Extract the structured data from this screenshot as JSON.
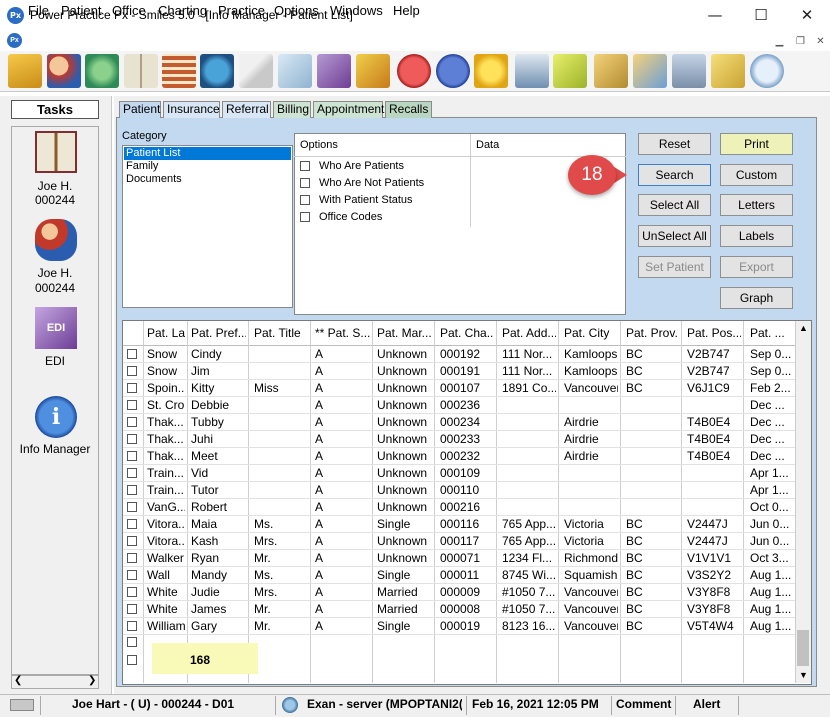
{
  "window": {
    "title": "Power Practice Px - Smiles 5.0 - [Info Manager - Patient List]",
    "app_icon_text": "Px",
    "minimize": "—",
    "maximize": "☐",
    "close": "✕"
  },
  "menu": {
    "items": [
      "File",
      "Patient",
      "Office",
      "Charting",
      "Practice",
      "Options",
      "Windows",
      "Help"
    ]
  },
  "toolbar": {
    "icons": [
      "folder-open-icon",
      "patients-icon",
      "recycle-icon",
      "chart-book-icon",
      "calendar-icon",
      "globe-icon",
      "mail-icon",
      "notes-icon",
      "edi-icon",
      "gift-icon",
      "stop-icon",
      "help-icon",
      "star-icon",
      "spray-icon",
      "postit-icon",
      "cabinet-icon",
      "monitor-folder-icon",
      "calculator-icon",
      "folders-icon",
      "chat-icon"
    ]
  },
  "tasks": {
    "header": "Tasks",
    "items": [
      {
        "label": "Joe H.",
        "sub": "000244",
        "icon": "chart-book-icon"
      },
      {
        "label": "Joe H.",
        "sub": "000244",
        "icon": "patients-icon"
      },
      {
        "label": "EDI",
        "sub": "",
        "icon": "edi-icon"
      },
      {
        "label": "Info Manager",
        "sub": "",
        "icon": "info-icon"
      }
    ]
  },
  "tabs": [
    "Patient",
    "Insurance",
    "Referral",
    "Billing",
    "Appointment",
    "Recalls"
  ],
  "category": {
    "label": "Category",
    "items": [
      "Patient List",
      "Family",
      "Documents"
    ],
    "selected": "Patient List"
  },
  "options": {
    "col_options": "Options",
    "col_data": "Data",
    "items": [
      "Who Are Patients",
      "Who Are Not Patients",
      "With Patient Status",
      "Office Codes"
    ]
  },
  "buttons": {
    "reset": "Reset",
    "print": "Print",
    "search": "Search",
    "custom": "Custom",
    "select_all": "Select All",
    "letters": "Letters",
    "unselect_all": "UnSelect All",
    "labels": "Labels",
    "set_patient": "Set Patient",
    "export": "Export",
    "graph": "Graph"
  },
  "callout": {
    "number": "18"
  },
  "grid": {
    "columns": [
      "Pat. Las...",
      "Pat. Pref...",
      "Pat. Title",
      "** Pat. S...",
      "Pat. Mar...",
      "Pat. Cha...",
      "Pat. Add...",
      "Pat. City",
      "Pat. Prov.",
      "Pat. Pos...",
      "Pat. ..."
    ],
    "rows": [
      [
        "Snow",
        "Cindy",
        "",
        "A",
        "Unknown",
        "000192",
        "111 Nor...",
        "Kamloops",
        "BC",
        "V2B747",
        "Sep 0..."
      ],
      [
        "Snow",
        "Jim",
        "",
        "A",
        "Unknown",
        "000191",
        "111 Nor...",
        "Kamloops",
        "BC",
        "V2B747",
        "Sep 0..."
      ],
      [
        "Spoin...",
        "Kitty",
        "Miss",
        "A",
        "Unknown",
        "000107",
        "1891 Co...",
        "Vancouver",
        "BC",
        "V6J1C9",
        "Feb 2..."
      ],
      [
        "St. Croix",
        "Debbie",
        "",
        "A",
        "Unknown",
        "000236",
        "",
        "",
        "",
        "",
        "Dec ..."
      ],
      [
        "Thak...",
        "Tubby",
        "",
        "A",
        "Unknown",
        "000234",
        "",
        "Airdrie",
        "",
        "T4B0E4",
        "Dec ..."
      ],
      [
        "Thak...",
        "Juhi",
        "",
        "A",
        "Unknown",
        "000233",
        "",
        "Airdrie",
        "",
        "T4B0E4",
        "Dec ..."
      ],
      [
        "Thak...",
        "Meet",
        "",
        "A",
        "Unknown",
        "000232",
        "",
        "Airdrie",
        "",
        "T4B0E4",
        "Dec ..."
      ],
      [
        "Train...",
        "Vid",
        "",
        "A",
        "Unknown",
        "000109",
        "",
        "",
        "",
        "",
        "Apr 1..."
      ],
      [
        "Train...",
        "Tutor",
        "",
        "A",
        "Unknown",
        "000110",
        "",
        "",
        "",
        "",
        "Apr 1..."
      ],
      [
        "VanG...",
        "Robert",
        "",
        "A",
        "Unknown",
        "000216",
        "",
        "",
        "",
        "",
        "Oct 0..."
      ],
      [
        "Vitora...",
        "Maia",
        "Ms.",
        "A",
        "Single",
        "000116",
        "765 App...",
        "Victoria",
        "BC",
        "V2447J",
        "Jun 0..."
      ],
      [
        "Vitora...",
        "Kash",
        "Mrs.",
        "A",
        "Unknown",
        "000117",
        "765 App...",
        "Victoria",
        "BC",
        "V2447J",
        "Jun 0..."
      ],
      [
        "Walker",
        "Ryan",
        "Mr.",
        "A",
        "Unknown",
        "000071",
        "1234 Fl...",
        "Richmond",
        "BC",
        "V1V1V1",
        "Oct 3..."
      ],
      [
        "Wall",
        "Mandy",
        "Ms.",
        "A",
        "Single",
        "000011",
        "8745 Wi...",
        "Squamish",
        "BC",
        "V3S2Y2",
        "Aug 1..."
      ],
      [
        "White",
        "Judie",
        "Mrs.",
        "A",
        "Married",
        "000009",
        "#1050 7...",
        "Vancouver",
        "BC",
        "V3Y8F8",
        "Aug 1..."
      ],
      [
        "White",
        "James",
        "Mr.",
        "A",
        "Married",
        "000008",
        "#1050 7...",
        "Vancouver",
        "BC",
        "V3Y8F8",
        "Aug 1..."
      ],
      [
        "Williams",
        "Gary",
        "Mr.",
        "A",
        "Single",
        "000019",
        "8123 16...",
        "Vancouver",
        "BC",
        "V5T4W4",
        "Aug 1..."
      ]
    ],
    "count": "168"
  },
  "status": {
    "patient": "Joe Hart - ( U) - 000244 - D01",
    "server": "Exan - server (MPOPTANI2(",
    "datetime": "Feb 16, 2021 12:05 PM",
    "comment": "Comment",
    "alert": "Alert"
  }
}
